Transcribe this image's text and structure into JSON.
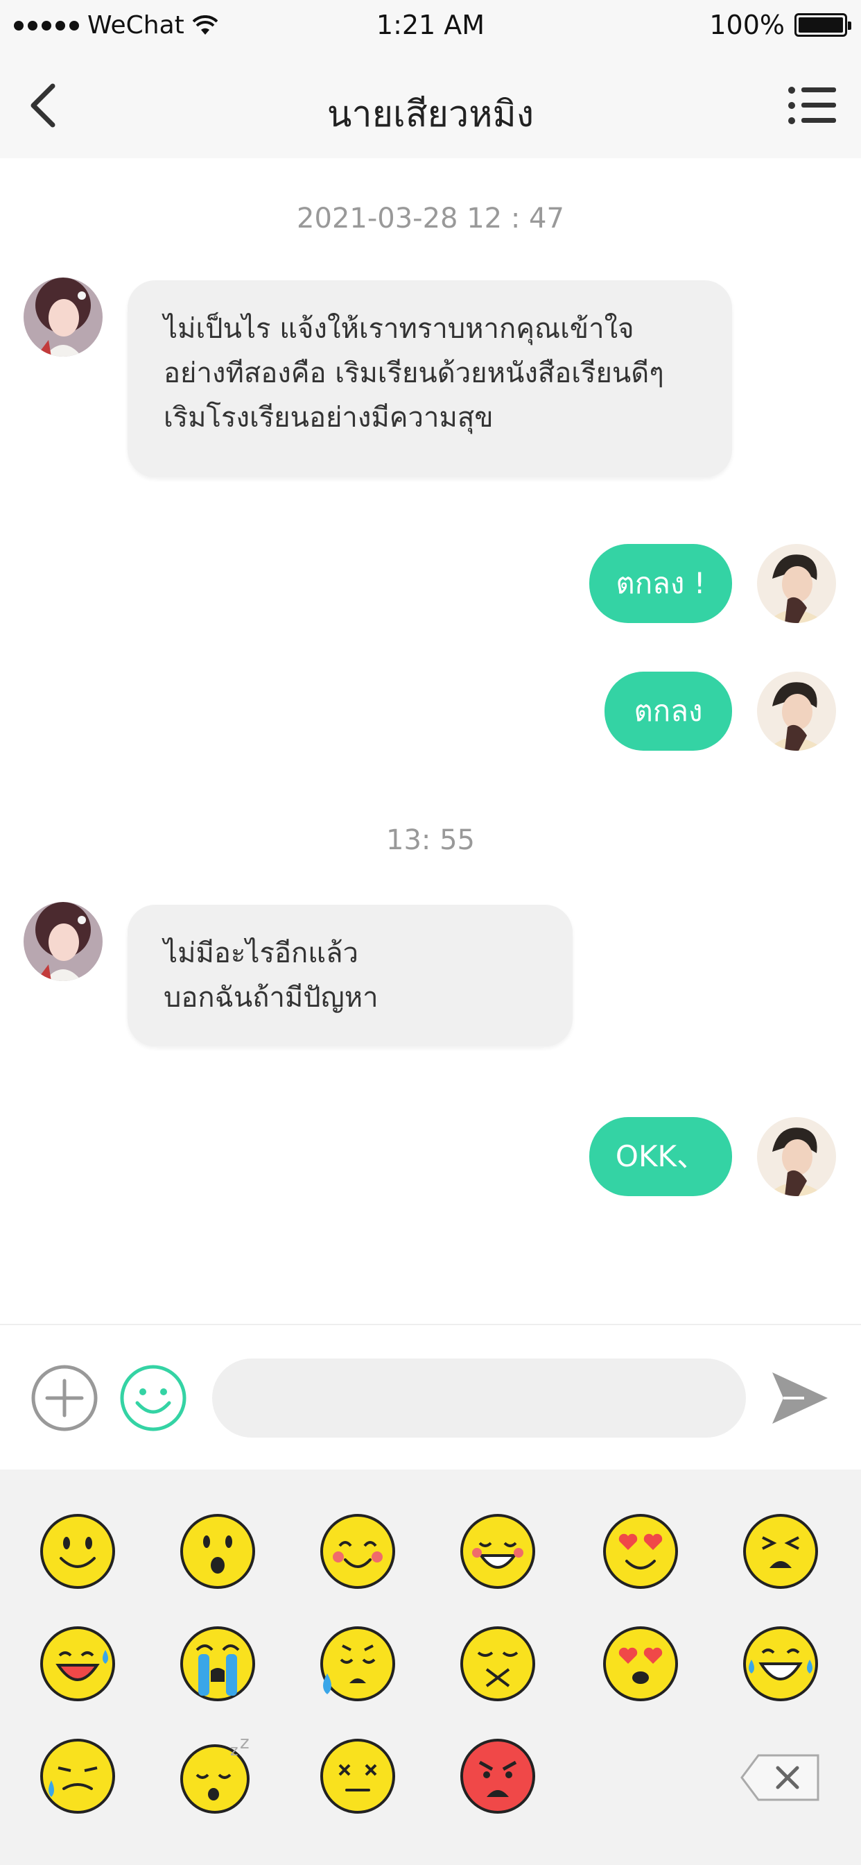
{
  "status_bar": {
    "carrier": "WeChat",
    "time": "1:21 AM",
    "battery": "100%"
  },
  "header": {
    "title": "นายเสียวหมิง"
  },
  "chat": {
    "timestamp_1": "2021-03-28  12 : 47",
    "timestamp_2": "13:  55",
    "messages": [
      {
        "sender": "other",
        "lines": [
          "ไม่เป็นไร แจ้งให้เราทราบหากคุณเข้าใจ",
          "อย่างทีสองคือ เริมเรียนด้วยหนังสือเรียนดีๆ",
          "เริมโรงเรียนอย่างมีความสุข"
        ]
      },
      {
        "sender": "me",
        "text": "ตกลง !"
      },
      {
        "sender": "me",
        "text": "ตกลง"
      },
      {
        "sender": "other",
        "lines": [
          "ไม่มีอะไรอีกแล้ว",
          "บอกฉันถ้ามีปัญหา"
        ]
      },
      {
        "sender": "me",
        "text": "OKK、"
      }
    ]
  },
  "input": {
    "placeholder": "",
    "value": ""
  },
  "emoji_panel": {
    "emojis": [
      "smile",
      "surprised",
      "blush",
      "laugh",
      "heart-eyes",
      "pained",
      "sweat-grin",
      "crying",
      "sad-sweat",
      "sealed-lips",
      "heart-eyes-blush",
      "tears-of-joy",
      "disappointed-sweat",
      "sleeping",
      "dizzy",
      "angry"
    ]
  },
  "colors": {
    "accent": "#34d3a4",
    "emoji_yellow": "#f9e11e",
    "angry_red": "#f04848"
  }
}
